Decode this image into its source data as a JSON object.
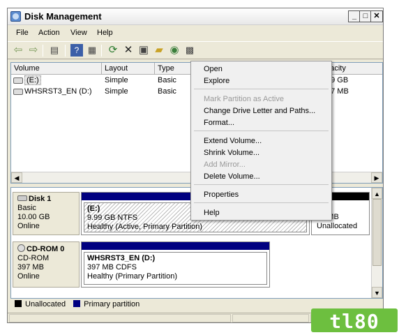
{
  "window": {
    "title": "Disk Management"
  },
  "menubar": {
    "items": [
      "File",
      "Action",
      "View",
      "Help"
    ]
  },
  "toolbar": {
    "icons": [
      "back-icon",
      "forward-icon",
      "show-hide-tree-icon",
      "help-icon",
      "console-icon",
      "refresh-icon",
      "delete-icon",
      "properties-icon",
      "open-icon",
      "explore-icon",
      "export-icon"
    ]
  },
  "volume_list": {
    "columns": [
      "Volume",
      "Layout",
      "Type",
      "Capacity"
    ],
    "capacity_partial": "apacity",
    "rows": [
      {
        "volume": "(E:)",
        "layout": "Simple",
        "type": "Basic",
        "capacity": "99 GB"
      },
      {
        "volume": "WHSRST3_EN (D:)",
        "layout": "Simple",
        "type": "Basic",
        "capacity": "97 MB"
      }
    ]
  },
  "context_menu": {
    "items": [
      {
        "label": "Open",
        "enabled": true
      },
      {
        "label": "Explore",
        "enabled": true
      },
      {
        "label": "Mark Partition as Active",
        "enabled": false
      },
      {
        "label": "Change Drive Letter and Paths...",
        "enabled": true
      },
      {
        "label": "Format...",
        "enabled": true
      },
      {
        "label": "Extend Volume...",
        "enabled": true
      },
      {
        "label": "Shrink Volume...",
        "enabled": true
      },
      {
        "label": "Add Mirror...",
        "enabled": false
      },
      {
        "label": "Delete Volume...",
        "enabled": true
      },
      {
        "label": "Properties",
        "enabled": true
      },
      {
        "label": "Help",
        "enabled": true
      }
    ]
  },
  "disks": [
    {
      "name": "Disk 1",
      "kind": "Basic",
      "size": "10.00 GB",
      "status": "Online",
      "partitions": [
        {
          "name": "(E:)",
          "size_fs": "9.99 GB NTFS",
          "health": "Healthy (Active, Primary Partition)"
        },
        {
          "name": "",
          "size_fs": "10 MB",
          "health": "Unallocated"
        }
      ]
    },
    {
      "name": "CD-ROM 0",
      "kind": "CD-ROM",
      "size": "397 MB",
      "status": "Online",
      "partitions": [
        {
          "name": "WHSRST3_EN (D:)",
          "size_fs": "397 MB CDFS",
          "health": "Healthy (Primary Partition)"
        }
      ]
    }
  ],
  "legend": {
    "unallocated": "Unallocated",
    "primary": "Primary partition"
  },
  "colors": {
    "primary_partition": "#000080",
    "unallocated": "#000000",
    "logo_green": "#6dbf3f"
  },
  "logo": {
    "text": "tl80"
  }
}
